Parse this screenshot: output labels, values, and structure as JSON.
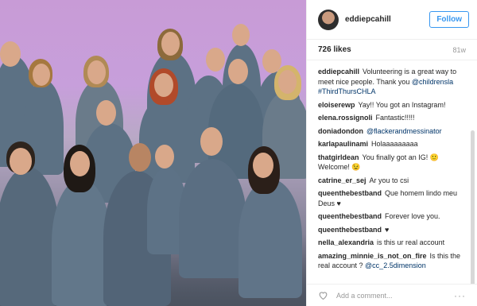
{
  "post": {
    "username": "eddiepcahill",
    "follow_label": "Follow",
    "likes": "726 likes",
    "age": "81w",
    "comments": [
      {
        "user": "eddiepcahill",
        "text": "Volunteering is a great way to meet nice people. Thank you @childrensla #ThirdThursCHLA"
      },
      {
        "user": "eloiserewp",
        "text": "Yay!! You got an Instagram!"
      },
      {
        "user": "elena.rossignoli",
        "text": "Fantastic!!!!!"
      },
      {
        "user": "doniadondon",
        "text": "@flackerandmessinator"
      },
      {
        "user": "karlapaulinami",
        "text": "Holaaaaaaaaa"
      },
      {
        "user": "thatgirldean",
        "text": "You finally got an IG! 🙂 Welcome! 😉"
      },
      {
        "user": "catrine_er_sej",
        "text": "Ar you to csi"
      },
      {
        "user": "queenthebestband",
        "text": "Que homem lindo meu Deus ♥"
      },
      {
        "user": "queenthebestband",
        "text": "Forever love you."
      },
      {
        "user": "queenthebestband",
        "text": "♥"
      },
      {
        "user": "nella_alexandria",
        "text": "is this ur real account"
      },
      {
        "user": "amazing_minnie_is_not_on_fire",
        "text": "Is this the real account ? @cc_2.5dimension"
      }
    ],
    "add_comment_placeholder": "Add a comment...",
    "more_icon": "···"
  },
  "colors": {
    "accent": "#3897f0",
    "link": "#003569",
    "muted": "#999999"
  }
}
